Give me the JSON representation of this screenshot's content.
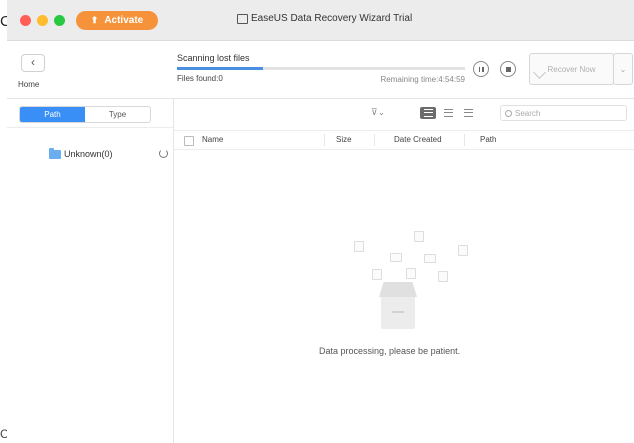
{
  "window": {
    "title": "EaseUS Data Recovery Wizard Trial"
  },
  "titlebar": {
    "activate_label": "Activate"
  },
  "edge": {
    "left_char_top": "C",
    "left_char_bottom": "C"
  },
  "toolbar": {
    "home_label": "Home",
    "scan_title": "Scanning lost files",
    "files_found": "Files found:0",
    "remaining": "Remaining time:4:54:59",
    "recover_label": "Recover Now",
    "progress_fraction": 0.3
  },
  "sidebar": {
    "tabs": [
      {
        "label": "Path",
        "active": true
      },
      {
        "label": "Type",
        "active": false
      }
    ],
    "tree": [
      {
        "label": "Unknown(0)"
      }
    ]
  },
  "main": {
    "search_placeholder": "Search",
    "columns": [
      "Name",
      "Size",
      "Date Created",
      "Path"
    ],
    "empty_message": "Data processing, please be patient."
  },
  "colors": {
    "accent": "#3a8ff6",
    "activate": "#f6923a",
    "progress": "#4a90e2"
  },
  "icons": [
    "back-arrow-icon",
    "pause-icon",
    "stop-icon",
    "filter-icon",
    "list-view-icon",
    "detail-view-icon",
    "thumbnail-view-icon",
    "search-icon",
    "folder-icon",
    "spinner-icon",
    "inbox-icon"
  ]
}
